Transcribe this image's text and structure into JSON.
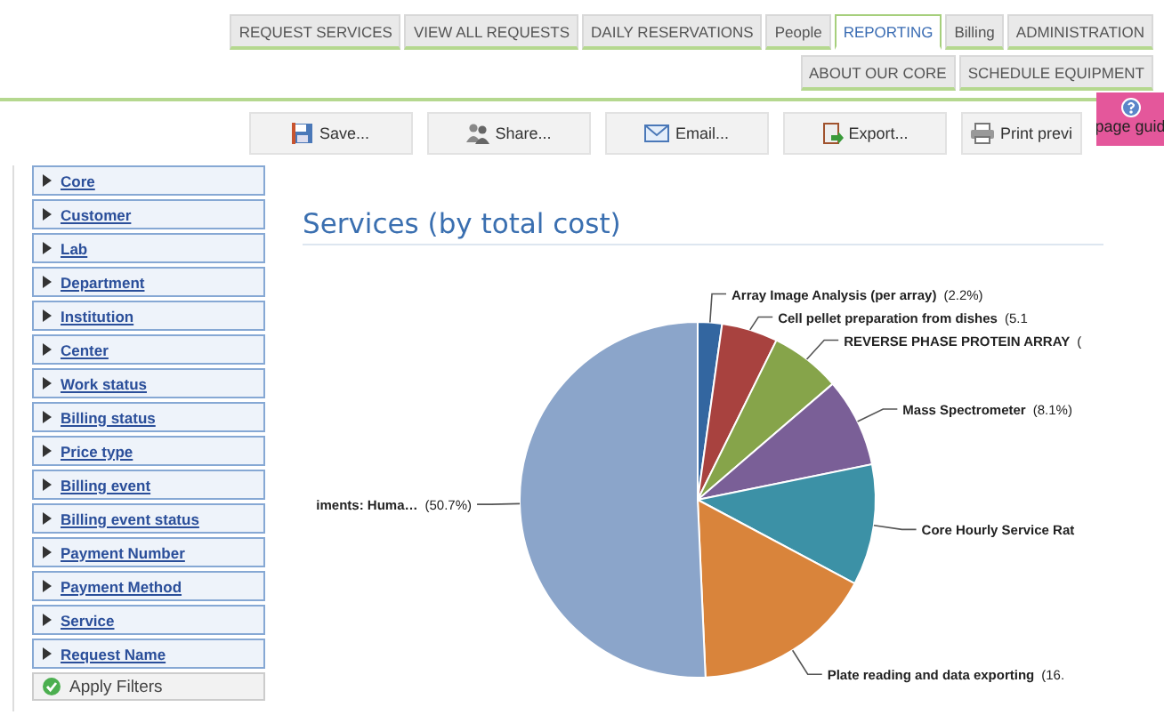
{
  "tabs": [
    {
      "label": "REQUEST SERVICES",
      "selected": false
    },
    {
      "label": "VIEW ALL REQUESTS",
      "selected": false
    },
    {
      "label": "DAILY RESERVATIONS",
      "selected": false
    },
    {
      "label": "People",
      "selected": false
    },
    {
      "label": "REPORTING",
      "selected": true
    },
    {
      "label": "Billing",
      "selected": false
    },
    {
      "label": "ADMINISTRATION",
      "selected": false
    }
  ],
  "secondary_tabs": [
    {
      "label": "ABOUT OUR CORE",
      "selected": false
    },
    {
      "label": "SCHEDULE EQUIPMENT",
      "selected": false
    }
  ],
  "toolbar": [
    {
      "kind": "save",
      "label": "Save..."
    },
    {
      "kind": "share",
      "label": "Share..."
    },
    {
      "kind": "email",
      "label": "Email..."
    },
    {
      "kind": "export",
      "label": "Export..."
    },
    {
      "kind": "print",
      "label": "Print previ"
    }
  ],
  "page_guide": {
    "label": "page guid"
  },
  "filters": [
    {
      "label": "Core",
      "expanded": false
    },
    {
      "label": "Customer",
      "expanded": false
    },
    {
      "label": "Lab",
      "expanded": false
    },
    {
      "label": "Department",
      "expanded": false
    },
    {
      "label": "Institution",
      "expanded": false
    },
    {
      "label": "Center",
      "expanded": false
    },
    {
      "label": "Work status",
      "expanded": false
    },
    {
      "label": "Billing status",
      "expanded": false
    },
    {
      "label": "Price type",
      "expanded": false
    },
    {
      "label": "Billing event",
      "expanded": false
    },
    {
      "label": "Billing event status",
      "expanded": false
    },
    {
      "label": "Payment Number",
      "expanded": false
    },
    {
      "label": "Payment Method",
      "expanded": false
    },
    {
      "label": "Service",
      "expanded": false
    },
    {
      "label": "Request Name",
      "expanded": false
    }
  ],
  "apply_button": {
    "label": "Apply Filters"
  },
  "chart": {
    "chart_data": {
      "type": "pie",
      "title": "Services (by total cost)",
      "categories": [
        "Array Image Analysis (per array)",
        "Cell pellet preparation from dishes",
        "REVERSE PHASE PROTEIN ARRAY",
        "Mass Spectrometer",
        "Core Hourly Service Rat",
        "Plate reading and data exporting",
        "iments: Huma…"
      ],
      "values": [
        2.2,
        5.1,
        6.4,
        8.1,
        11.0,
        16.5,
        50.7
      ],
      "value_labels": [
        "(2.2%)",
        "(5.1",
        "(",
        "(8.1%)",
        null,
        "(16.",
        "(50.7%)"
      ],
      "colors": [
        "#3366a0",
        "#a8423f",
        "#86a44a",
        "#7a5f97",
        "#3c91a6",
        "#d9843b",
        "#8ba5ca"
      ]
    }
  }
}
